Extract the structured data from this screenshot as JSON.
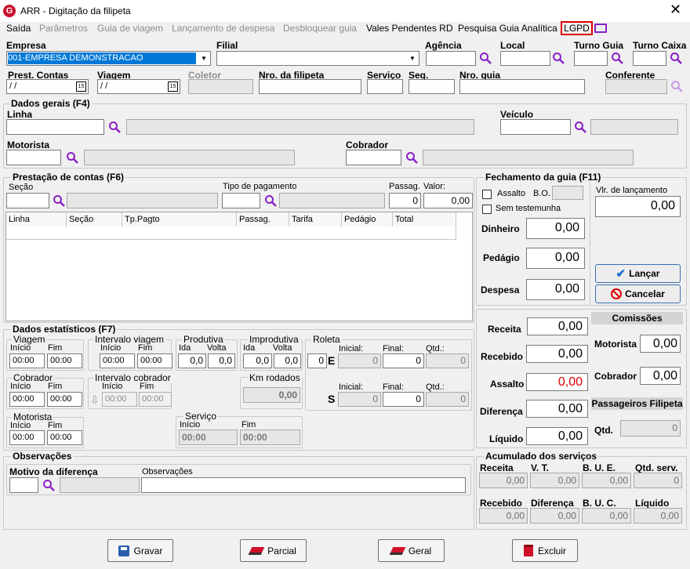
{
  "window": {
    "title": "ARR - Digitação da filipeta",
    "app_letter": "G"
  },
  "menu": {
    "items": [
      "Saída",
      "Parâmetros",
      "Guia de viagem",
      "Lançamento de despesa",
      "Desbloquear guia",
      "Vales Pendentes RD",
      "Pesquisa Guia Analítica",
      "LGPD"
    ]
  },
  "header": {
    "empresa_label": "Empresa",
    "empresa_value": "001-EMPRESA DEMONSTRACAO",
    "filial_label": "Filial",
    "agencia_label": "Agência",
    "local_label": "Local",
    "turno_guia_label": "Turno Guia",
    "turno_caixa_label": "Turno Caixa",
    "prest_label": "Prest. Contas",
    "prest_value": " / /",
    "viagem_label": "Viagem",
    "viagem_value": " / /",
    "coletor_label": "Coletor",
    "nro_filipeta_label": "Nro. da filipeta",
    "servico_label": "Serviço",
    "seq_label": "Seq.",
    "nro_guia_label": "Nro. guia",
    "conferente_label": "Conferente"
  },
  "dados_gerais": {
    "title": "Dados gerais (F4)",
    "linha_label": "Linha",
    "veiculo_label": "Veículo",
    "motorista_label": "Motorista",
    "cobrador_label": "Cobrador"
  },
  "prestacao": {
    "title": "Prestação de contas (F6)",
    "secao_label": "Seção",
    "tipo_pagamento_label": "Tipo de pagamento",
    "passag_label": "Passag.",
    "passag_value": "0",
    "valor_label": "Valor:",
    "valor_value": "0,00",
    "columns": [
      "Linha",
      "Seção",
      "Tp.Pagto",
      "Passag.",
      "Tarifa",
      "Pedágio",
      "Total"
    ]
  },
  "fechamento": {
    "title": "Fechamento da guia (F11)",
    "assalto_label": "Assalto",
    "bo_label": "B.O.",
    "sem_testemunha_label": "Sem testemunha",
    "dinheiro_label": "Dinheiro",
    "dinheiro_value": "0,00",
    "pedagio_label": "Pedágio",
    "pedagio_value": "0,00",
    "despesa_label": "Despesa",
    "despesa_value": "0,00",
    "vlr_lancamento_label": "Vlr. de lançamento",
    "vlr_lancamento_value": "0,00",
    "lancar_label": "Lançar",
    "cancelar_label": "Cancelar"
  },
  "estatisticos": {
    "title": "Dados estatísticos (F7)",
    "viagem_label": "Viagem",
    "inicio_label": "Início",
    "fim_label": "Fim",
    "time_value": "00:00",
    "intervalo_viagem_label": "Intervalo viagem",
    "produtiva_label": "Produtiva",
    "improdutiva_label": "Improdutiva",
    "ida_label": "Ida",
    "volta_label": "Volta",
    "dec_value": "0,0",
    "roleta_label": "Roleta",
    "roleta_value": "0",
    "e_label": "E",
    "s_label": "S",
    "inicial_label": "Inicial:",
    "final_label": "Final:",
    "qtd_label": "Qtd.:",
    "zero": "0",
    "cobrador_label": "Cobrador",
    "intervalo_cobrador_label": "Intervalo cobrador",
    "km_rodados_label": "Km rodados",
    "km_value": "0,00",
    "motorista_label": "Motorista",
    "servico_label": "Serviço"
  },
  "resumo": {
    "receita_label": "Receita",
    "receita_value": "0,00",
    "recebido_label": "Recebido",
    "recebido_value": "0,00",
    "assalto_label": "Assalto",
    "assalto_value": "0,00",
    "diferenca_label": "Diferença",
    "diferenca_value": "0,00",
    "liquido_label": "Líquido",
    "liquido_value": "0,00",
    "comissoes_title": "Comissões",
    "motorista_label": "Motorista",
    "motorista_value": "0,00",
    "cobrador_label": "Cobrador",
    "cobrador_value": "0,00",
    "passageiros_title": "Passageiros Filipeta",
    "qtd_label": "Qtd.",
    "qtd_value": "0"
  },
  "observacoes": {
    "title": "Observações",
    "motivo_label": "Motivo da diferença",
    "observacoes_label": "Observações"
  },
  "acumulado": {
    "title": "Acumulado dos serviços",
    "labels1": [
      "Receita",
      "V. T.",
      "B. U. E.",
      "Qtd. serv."
    ],
    "values1": [
      "0,00",
      "0,00",
      "0,00",
      "0"
    ],
    "labels2": [
      "Recebido",
      "Diferença",
      "B. U. C.",
      "Líquido"
    ],
    "values2": [
      "0,00",
      "0,00",
      "0,00",
      "0,00"
    ]
  },
  "actions": {
    "gravar": "Gravar",
    "parcial": "Parcial",
    "geral": "Geral",
    "excluir": "Excluir"
  },
  "colors": {
    "accent_purple": "#8a20c8",
    "selection": "#0078d7",
    "red": "#e00000"
  }
}
